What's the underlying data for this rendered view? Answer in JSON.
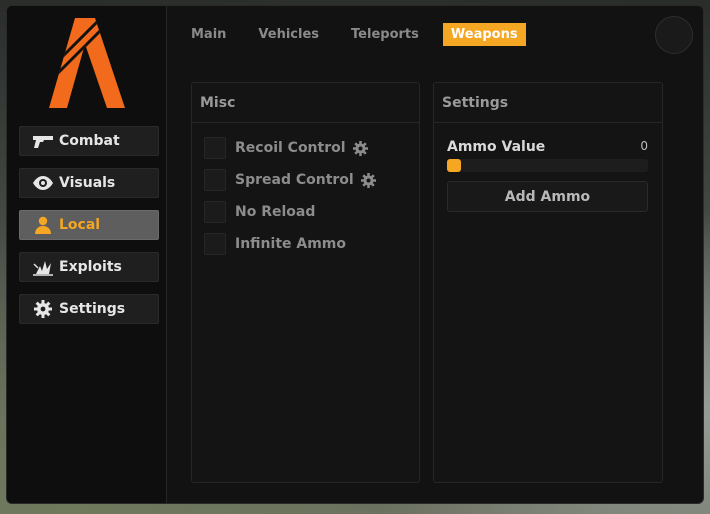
{
  "sidebar": {
    "items": [
      {
        "label": "Combat",
        "icon": "gun-icon",
        "active": false
      },
      {
        "label": "Visuals",
        "icon": "eye-icon",
        "active": false
      },
      {
        "label": "Local",
        "icon": "user-icon",
        "active": true
      },
      {
        "label": "Exploits",
        "icon": "explosion-icon",
        "active": false
      },
      {
        "label": "Settings",
        "icon": "gear-icon",
        "active": false
      }
    ]
  },
  "tabs": [
    {
      "label": "Main",
      "active": false
    },
    {
      "label": "Vehicles",
      "active": false
    },
    {
      "label": "Teleports",
      "active": false
    },
    {
      "label": "Weapons",
      "active": true
    }
  ],
  "misc": {
    "title": "Misc",
    "options": [
      {
        "label": "Recoil Control",
        "checked": false,
        "has_settings": true
      },
      {
        "label": "Spread Control",
        "checked": false,
        "has_settings": true
      },
      {
        "label": "No Reload",
        "checked": false,
        "has_settings": false
      },
      {
        "label": "Infinite Ammo",
        "checked": false,
        "has_settings": false
      }
    ]
  },
  "settings": {
    "title": "Settings",
    "ammo_label": "Ammo Value",
    "ammo_value": "0",
    "ammo_fraction": 0,
    "add_ammo_label": "Add Ammo"
  },
  "colors": {
    "accent": "#f5a623",
    "background": "#121212",
    "panel": "#141414"
  }
}
